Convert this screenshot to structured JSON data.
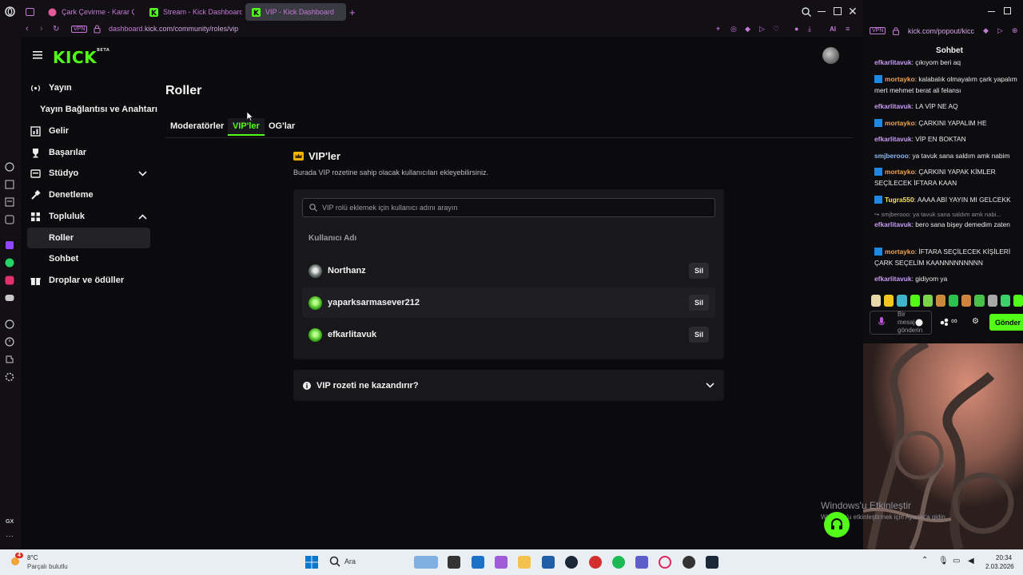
{
  "browser": {
    "tabs": [
      {
        "title": "Çark Çevirme - Karar Çark",
        "active": false
      },
      {
        "title": "Stream - Kick Dashboard",
        "active": false
      },
      {
        "title": "VIP - Kick Dashboard",
        "active": true
      }
    ],
    "vpn_label": "VPN",
    "url_prefix": "dashboard.",
    "url_rest": "kick.com/community/roles/vip",
    "ai_label": "AI"
  },
  "sidebar": {
    "logo": "KICK",
    "logo_sup": "BETA",
    "items": [
      {
        "label": "Yayın",
        "icon": "broadcast-icon"
      },
      {
        "label": "Yayın Bağlantısı ve Anahtarı",
        "icon": ""
      },
      {
        "label": "Gelir",
        "icon": "revenue-icon"
      },
      {
        "label": "Başarılar",
        "icon": "trophy-icon"
      },
      {
        "label": "Stüdyo",
        "icon": "studio-icon"
      },
      {
        "label": "Denetleme",
        "icon": "moderation-icon"
      },
      {
        "label": "Topluluk",
        "icon": "community-icon"
      },
      {
        "label": "Roller",
        "icon": ""
      },
      {
        "label": "Sohbet",
        "icon": ""
      },
      {
        "label": "Droplar ve ödüller",
        "icon": "drops-icon"
      }
    ]
  },
  "main": {
    "title": "Roller",
    "tabs": [
      {
        "label": "Moderatörler",
        "active": false
      },
      {
        "label": "VIP'ler",
        "active": true
      },
      {
        "label": "OG'lar",
        "active": false
      }
    ],
    "vip_heading": "VIP'ler",
    "vip_description": "Burada VIP rozetine sahip olacak kullanıcıları ekleyebilirsiniz.",
    "search_placeholder": "VIP rolü eklemek için kullanıcı adını arayın",
    "column_header": "Kullanıcı Adı",
    "users": [
      {
        "name": "Northanz",
        "action": "Sil"
      },
      {
        "name": "yaparksarmasever212",
        "action": "Sil"
      },
      {
        "name": "efkarlitavuk",
        "action": "Sil"
      }
    ],
    "faq_label": "VIP rozeti ne kazandırır?"
  },
  "chat": {
    "vpn_label": "VPN",
    "url": "kick.com/popout/kicc",
    "title": "Sohbet",
    "messages": [
      {
        "user": "efkarlitavuk",
        "text": "çıkıyom beri aq",
        "color": "#c79bf5",
        "badge": false
      },
      {
        "user": "mortayko",
        "text": "kalabalık olmayalım çark yapalım mert mehmet berat ali felansı",
        "color": "#f0a24b",
        "badge": true
      },
      {
        "user": "efkarlitavuk",
        "text": "LA VİP NE AQ",
        "color": "#c79bf5",
        "badge": false
      },
      {
        "user": "mortayko",
        "text": "ÇARKINI YAPALIM HE",
        "color": "#f0a24b",
        "badge": true
      },
      {
        "user": "efkarlitavuk",
        "text": "VİP EN BOKTAN",
        "color": "#c79bf5",
        "badge": false
      },
      {
        "user": "smjberooo",
        "text": "ya tavuk sana saldım amk nabim",
        "color": "#8ab4f8",
        "badge": false
      },
      {
        "user": "mortayko",
        "text": "ÇARKINI YAPAK KİMLER SEÇİLECEK İFTARA KAAN",
        "color": "#f0a24b",
        "badge": true
      },
      {
        "user": "Tugra550",
        "text": "AAAA ABİ YAYIN MI GELCEKK",
        "color": "#f5e15b",
        "badge": true
      },
      {
        "user": "",
        "text": "↪ smjberooo: ya tavuk sana saldım amk nabi...",
        "color": "#8b8b93",
        "badge": false,
        "reply": true
      },
      {
        "user": "efkarlitavuk",
        "text": "bero sana bişey demedim zaten",
        "color": "#c79bf5",
        "badge": false
      },
      {
        "user": "mortayko",
        "text": "İFTARA SEÇİLECEK KİŞİLERİ ÇARK SEÇELİM KAANNNNNNNNN",
        "color": "#f0a24b",
        "badge": true
      },
      {
        "user": "efkarlitavuk",
        "text": "gidiyom ya",
        "color": "#c79bf5",
        "badge": false
      }
    ],
    "input_placeholder": "Bir mesaj gönderin",
    "send_label": "Gönder"
  },
  "overlay": {
    "watermark_title": "Windows'u Etkinleştir",
    "watermark_sub": "Windows'u etkinleştirmek için Ayarlar'a gidin."
  },
  "taskbar": {
    "weather_temp": "8°C",
    "weather_desc": "Parçalı bulutlu",
    "weather_badge": "4",
    "search_label": "Ara",
    "time": "20:34",
    "date": "2.03.2026"
  }
}
